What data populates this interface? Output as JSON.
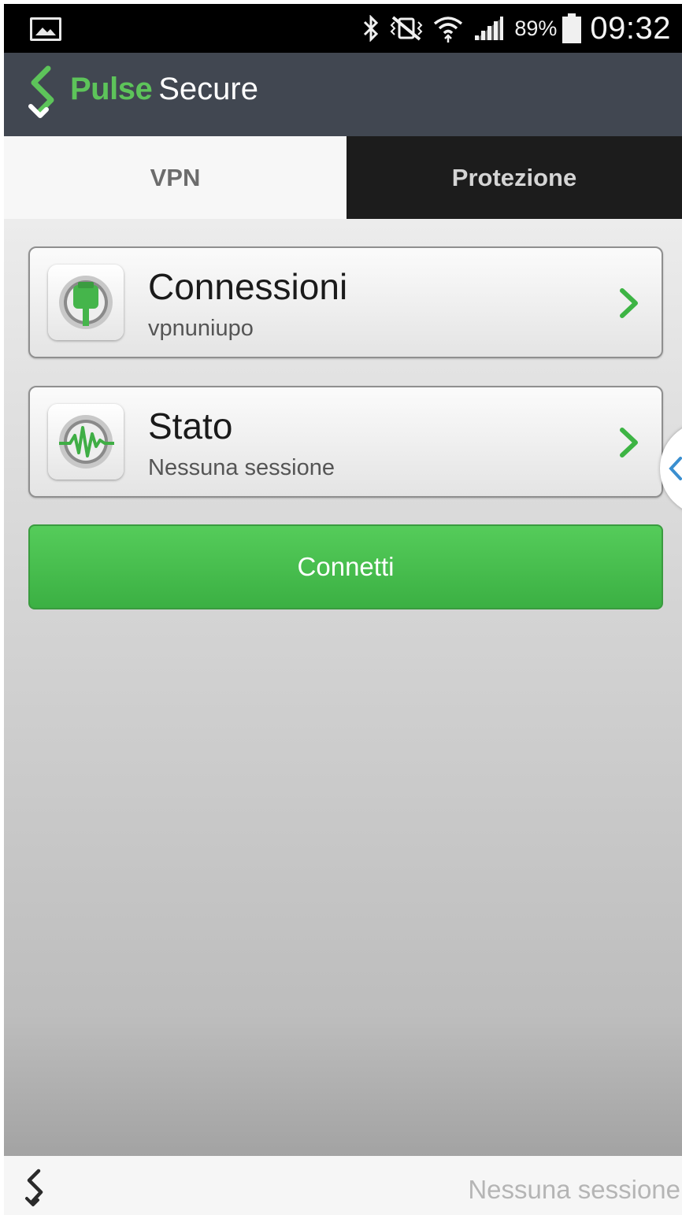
{
  "status_bar": {
    "gallery_icon": "image-notification-icon",
    "icons": [
      "bluetooth-icon",
      "vibrate-icon",
      "wifi-icon",
      "signal-icon"
    ],
    "battery_percent": "89%",
    "battery_icon": "battery-icon",
    "time": "09:32"
  },
  "header": {
    "logo_icon": "pulse-secure-logo",
    "brand_pulse": "Pulse",
    "brand_secure": "Secure"
  },
  "tabs": [
    {
      "label": "VPN",
      "active": true
    },
    {
      "label": "Protezione",
      "active": false
    }
  ],
  "cards": [
    {
      "title": "Connessioni",
      "subtitle": "vpnuniupo",
      "icon": "connection-plug-icon"
    },
    {
      "title": "Stato",
      "subtitle": "Nessuna sessione",
      "icon": "status-pulse-icon"
    }
  ],
  "connect_button": {
    "label": "Connetti"
  },
  "footer": {
    "status": "Nessuna sessione"
  },
  "colors": {
    "accent_green": "#4fc353",
    "header_bg": "#414751",
    "tab_inactive_bg": "#1c1c1c"
  }
}
